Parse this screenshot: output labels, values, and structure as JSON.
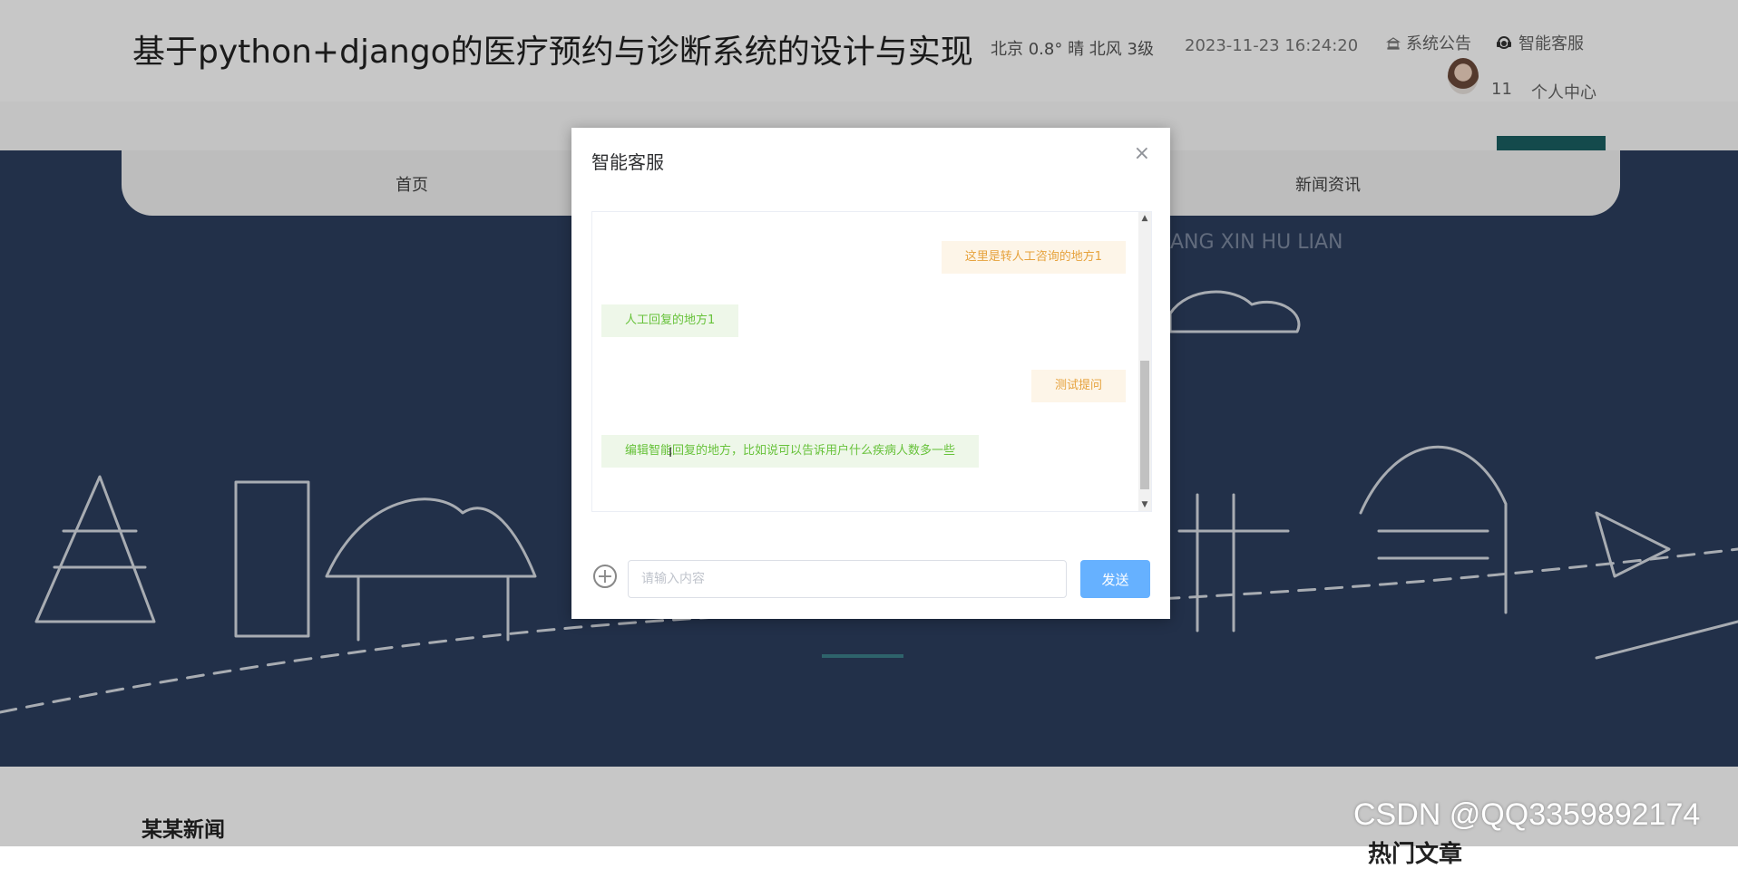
{
  "header": {
    "title": "基于python+django的医疗预约与诊断系统的设计与实现",
    "weather": "北京 0.8° 晴 北风 3级",
    "datetime": "2023-11-23 16:24:20",
    "links": {
      "announcement": "系统公告",
      "customer_service": "智能客服"
    },
    "user": {
      "number": "11",
      "center_label": "个人中心"
    }
  },
  "nav": {
    "items": [
      "首页",
      "新闻资讯"
    ]
  },
  "hero": {
    "partial_text": "ANG XIN HU LIAN"
  },
  "content": {
    "news_heading": "某某新闻",
    "hot_heading": "热门文章"
  },
  "watermark": "CSDN @QQ3359892174",
  "dialog": {
    "title": "智能客服",
    "messages": [
      {
        "role": "user",
        "text": "这里是转人工咨询的地方1"
      },
      {
        "role": "agent",
        "text": "人工回复的地方1"
      },
      {
        "role": "user",
        "text": "测试提问"
      },
      {
        "role": "agent",
        "text": "编辑智能回复的地方，比如说可以告诉用户什么疾病人数多一些"
      }
    ],
    "input_placeholder": "请输入内容",
    "send_label": "发送"
  },
  "icons": {
    "announcement": "bank-icon",
    "customer_service": "headset-icon",
    "add": "plus-circle-icon",
    "close": "close-icon"
  },
  "colors": {
    "hero_bg": "#2c3e5e",
    "send_button": "#66b1ff",
    "user_bubble_text": "#e6a23c",
    "agent_bubble_text": "#67c23a",
    "accent_teal": "#1a5f62"
  }
}
